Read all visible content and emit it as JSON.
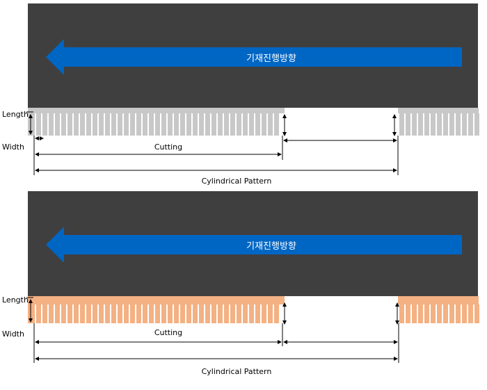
{
  "panels": [
    {
      "direction_label": "기재진행방향",
      "length_label": "Length",
      "width_label": "Width",
      "cutting_label": "Cutting",
      "pattern_label": "Cylindrical Pattern",
      "strip_color": "#c8c8c8"
    },
    {
      "direction_label": "기재진행방향",
      "length_label": "Length",
      "width_label": "Width",
      "cutting_label": "Cutting",
      "pattern_label": "Cylindrical Pattern",
      "strip_color": "#f4b183"
    }
  ],
  "colors": {
    "background_panel": "#3f3f3f",
    "arrow": "#0066c4"
  }
}
